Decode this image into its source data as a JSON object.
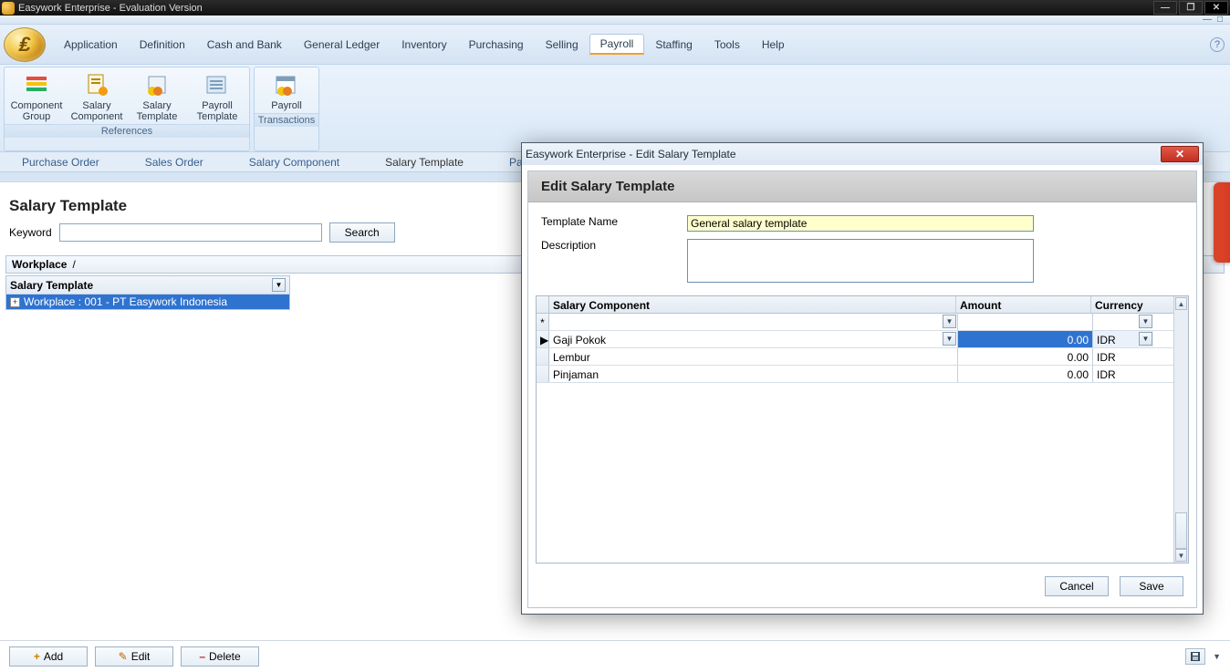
{
  "window": {
    "title": "Easywork Enterprise - Evaluation Version"
  },
  "menu": {
    "items": [
      "Application",
      "Definition",
      "Cash and Bank",
      "General Ledger",
      "Inventory",
      "Purchasing",
      "Selling",
      "Payroll",
      "Staffing",
      "Tools",
      "Help"
    ],
    "active_index": 7
  },
  "ribbon": {
    "groups": [
      {
        "name": "References",
        "buttons": [
          {
            "label1": "Component",
            "label2": "Group"
          },
          {
            "label1": "Salary",
            "label2": "Component"
          },
          {
            "label1": "Salary",
            "label2": "Template"
          },
          {
            "label1": "Payroll",
            "label2": "Template"
          }
        ]
      },
      {
        "name": "Transactions",
        "buttons": [
          {
            "label1": "Payroll",
            "label2": ""
          }
        ]
      }
    ]
  },
  "doctabs": {
    "items": [
      "Purchase Order",
      "Sales Order",
      "Salary Component",
      "Salary Template",
      "Payroll",
      "Pa"
    ],
    "active_index": 3
  },
  "page": {
    "title": "Salary Template",
    "keyword_label": "Keyword",
    "keyword_value": "",
    "search_label": "Search",
    "breadcrumb": {
      "root": "Workplace",
      "sep": "/"
    },
    "grid_header": "Salary Template",
    "row0": "Workplace : 001 - PT Easywork Indonesia"
  },
  "actions": {
    "add": "Add",
    "edit": "Edit",
    "delete": "Delete"
  },
  "modal": {
    "window_title": "Easywork Enterprise - Edit Salary Template",
    "heading": "Edit Salary Template",
    "template_name_label": "Template Name",
    "template_name_value": "General salary template",
    "description_label": "Description",
    "description_value": "",
    "cols": {
      "c1": "Salary Component",
      "c2": "Amount",
      "c3": "Currency"
    },
    "rows": [
      {
        "marker": "*",
        "component": "",
        "amount": "",
        "currency": "",
        "has_dd": true,
        "has_curdd": true
      },
      {
        "marker": "▶",
        "component": "Gaji Pokok",
        "amount": "0.00",
        "currency": "IDR",
        "selected": true,
        "has_dd": true,
        "has_curdd": true
      },
      {
        "marker": "",
        "component": "Lembur",
        "amount": "0.00",
        "currency": "IDR"
      },
      {
        "marker": "",
        "component": "Pinjaman",
        "amount": "0.00",
        "currency": "IDR"
      }
    ],
    "cancel": "Cancel",
    "save": "Save"
  }
}
